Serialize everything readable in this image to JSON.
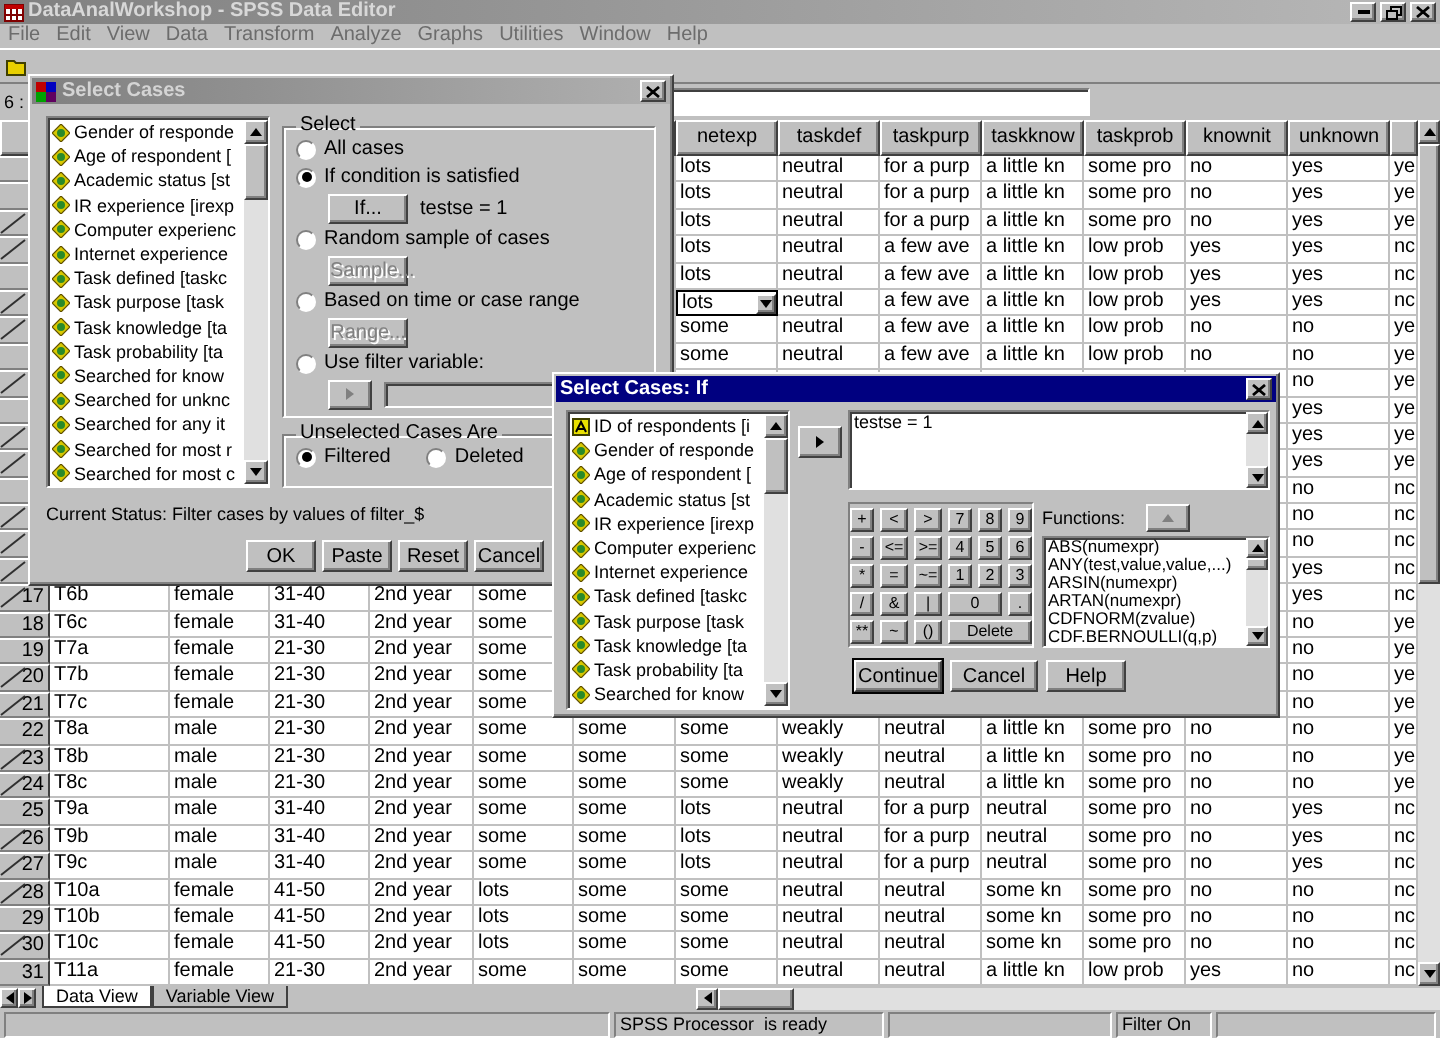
{
  "window": {
    "title": "DataAnalWorkshop - SPSS Data Editor"
  },
  "menu": [
    "File",
    "Edit",
    "View",
    "Data",
    "Transform",
    "Analyze",
    "Graphs",
    "Utilities",
    "Window",
    "Help"
  ],
  "cell_editor": {
    "label": "6 :"
  },
  "grid": {
    "columns": [
      null,
      null,
      null,
      null,
      null,
      null,
      "netexp",
      "taskdef",
      "taskpurp",
      "taskknow",
      "taskprob",
      "knownit",
      "unknown",
      null
    ],
    "rows": [
      {
        "number": null,
        "filtered": false,
        "cells": [
          null,
          null,
          null,
          null,
          null,
          null,
          "lots",
          "neutral",
          "for a purp",
          "a little kn",
          "some pro",
          "no",
          "yes",
          "ye"
        ]
      },
      {
        "number": null,
        "filtered": false,
        "cells": [
          null,
          null,
          null,
          null,
          null,
          null,
          "lots",
          "neutral",
          "for a purp",
          "a little kn",
          "some pro",
          "no",
          "yes",
          "ye"
        ]
      },
      {
        "number": null,
        "filtered": true,
        "cells": [
          null,
          null,
          null,
          null,
          null,
          null,
          "lots",
          "neutral",
          "for a purp",
          "a little kn",
          "some pro",
          "no",
          "yes",
          "ye"
        ]
      },
      {
        "number": null,
        "filtered": true,
        "cells": [
          null,
          null,
          null,
          null,
          null,
          null,
          "lots",
          "neutral",
          "a few ave",
          "a little kn",
          "low prob",
          "yes",
          "yes",
          "nc"
        ]
      },
      {
        "number": null,
        "filtered": false,
        "cells": [
          null,
          null,
          null,
          null,
          null,
          null,
          "lots",
          "neutral",
          "a few ave",
          "a little kn",
          "low prob",
          "yes",
          "yes",
          "nc"
        ]
      },
      {
        "number": null,
        "filtered": true,
        "cells": [
          null,
          null,
          null,
          null,
          null,
          null,
          {
            "text": "lots",
            "dropdown": true
          },
          "neutral",
          "a few ave",
          "a little kn",
          "low prob",
          "yes",
          "yes",
          "nc"
        ]
      },
      {
        "number": null,
        "filtered": true,
        "cells": [
          null,
          null,
          null,
          null,
          null,
          null,
          "some",
          "neutral",
          "a few ave",
          "a little kn",
          "low prob",
          "no",
          "no",
          "ye"
        ]
      },
      {
        "number": null,
        "filtered": false,
        "cells": [
          null,
          null,
          null,
          null,
          null,
          null,
          "some",
          "neutral",
          "a few ave",
          "a little kn",
          "low prob",
          "no",
          "no",
          "ye"
        ]
      },
      {
        "number": null,
        "filtered": true,
        "cells": [
          null,
          null,
          null,
          null,
          null,
          null,
          null,
          null,
          null,
          null,
          null,
          null,
          "no",
          "ye"
        ]
      },
      {
        "number": null,
        "filtered": false,
        "cells": [
          null,
          null,
          null,
          null,
          null,
          null,
          null,
          null,
          null,
          null,
          null,
          null,
          "yes",
          "ye"
        ]
      },
      {
        "number": null,
        "filtered": true,
        "cells": [
          null,
          null,
          null,
          null,
          null,
          null,
          null,
          null,
          null,
          null,
          null,
          null,
          "yes",
          "ye"
        ]
      },
      {
        "number": null,
        "filtered": true,
        "cells": [
          null,
          null,
          null,
          null,
          null,
          null,
          null,
          null,
          null,
          null,
          null,
          null,
          "yes",
          "ye"
        ]
      },
      {
        "number": null,
        "filtered": false,
        "cells": [
          null,
          null,
          null,
          null,
          null,
          null,
          null,
          null,
          null,
          null,
          null,
          null,
          "no",
          "nc"
        ]
      },
      {
        "number": null,
        "filtered": true,
        "cells": [
          null,
          null,
          null,
          null,
          null,
          null,
          null,
          null,
          null,
          null,
          null,
          null,
          "no",
          "nc"
        ]
      },
      {
        "number": null,
        "filtered": true,
        "cells": [
          null,
          null,
          null,
          null,
          null,
          null,
          null,
          null,
          null,
          null,
          null,
          null,
          "no",
          "nc"
        ]
      },
      {
        "number": null,
        "filtered": true,
        "cells": [
          null,
          null,
          null,
          null,
          null,
          null,
          null,
          null,
          null,
          null,
          null,
          null,
          "yes",
          "nc"
        ]
      },
      {
        "number": "17",
        "filtered": true,
        "cells": [
          "T6b",
          "female",
          "31-40",
          "2nd year",
          "some",
          null,
          null,
          null,
          null,
          null,
          null,
          null,
          "yes",
          "nc"
        ]
      },
      {
        "number": "18",
        "filtered": false,
        "cells": [
          "T6c",
          "female",
          "31-40",
          "2nd year",
          "some",
          null,
          null,
          null,
          null,
          null,
          null,
          null,
          "no",
          "ye"
        ]
      },
      {
        "number": "19",
        "filtered": false,
        "cells": [
          "T7a",
          "female",
          "21-30",
          "2nd year",
          "some",
          null,
          null,
          null,
          null,
          null,
          null,
          null,
          "no",
          "ye"
        ]
      },
      {
        "number": "20",
        "filtered": true,
        "cells": [
          "T7b",
          "female",
          "21-30",
          "2nd year",
          "some",
          null,
          null,
          null,
          null,
          null,
          null,
          null,
          "no",
          "ye"
        ]
      },
      {
        "number": "21",
        "filtered": true,
        "cells": [
          "T7c",
          "female",
          "21-30",
          "2nd year",
          "some",
          null,
          null,
          null,
          null,
          null,
          null,
          null,
          "no",
          "ye"
        ]
      },
      {
        "number": "22",
        "filtered": false,
        "cells": [
          "T8a",
          "male",
          "21-30",
          "2nd year",
          "some",
          "some",
          "some",
          "weakly",
          "neutral",
          "a little kn",
          "some pro",
          "no",
          "no",
          "ye"
        ]
      },
      {
        "number": "23",
        "filtered": true,
        "cells": [
          "T8b",
          "male",
          "21-30",
          "2nd year",
          "some",
          "some",
          "some",
          "weakly",
          "neutral",
          "a little kn",
          "some pro",
          "no",
          "no",
          "ye"
        ]
      },
      {
        "number": "24",
        "filtered": true,
        "cells": [
          "T8c",
          "male",
          "21-30",
          "2nd year",
          "some",
          "some",
          "some",
          "weakly",
          "neutral",
          "a little kn",
          "some pro",
          "no",
          "no",
          "ye"
        ]
      },
      {
        "number": "25",
        "filtered": false,
        "cells": [
          "T9a",
          "male",
          "31-40",
          "2nd year",
          "some",
          "some",
          "lots",
          "neutral",
          "for a purp",
          "neutral",
          "some pro",
          "no",
          "yes",
          "nc"
        ]
      },
      {
        "number": "26",
        "filtered": true,
        "cells": [
          "T9b",
          "male",
          "31-40",
          "2nd year",
          "some",
          "some",
          "lots",
          "neutral",
          "for a purp",
          "neutral",
          "some pro",
          "no",
          "yes",
          "nc"
        ]
      },
      {
        "number": "27",
        "filtered": true,
        "cells": [
          "T9c",
          "male",
          "31-40",
          "2nd year",
          "some",
          "some",
          "lots",
          "neutral",
          "for a purp",
          "neutral",
          "some pro",
          "no",
          "yes",
          "nc"
        ]
      },
      {
        "number": "28",
        "filtered": true,
        "cells": [
          "T10a",
          "female",
          "41-50",
          "2nd year",
          "lots",
          "some",
          "some",
          "neutral",
          "neutral",
          "some kn",
          "some pro",
          "no",
          "no",
          "nc"
        ]
      },
      {
        "number": "29",
        "filtered": false,
        "cells": [
          "T10b",
          "female",
          "41-50",
          "2nd year",
          "lots",
          "some",
          "some",
          "neutral",
          "neutral",
          "some kn",
          "some pro",
          "no",
          "no",
          "nc"
        ]
      },
      {
        "number": "30",
        "filtered": true,
        "cells": [
          "T10c",
          "female",
          "41-50",
          "2nd year",
          "lots",
          "some",
          "some",
          "neutral",
          "neutral",
          "some kn",
          "some pro",
          "no",
          "no",
          "nc"
        ]
      },
      {
        "number": "31",
        "filtered": false,
        "cells": [
          "T11a",
          "female",
          "21-30",
          "2nd year",
          "some",
          "some",
          "some",
          "neutral",
          "neutral",
          "a little kn",
          "low prob",
          "yes",
          "no",
          "nc"
        ]
      }
    ]
  },
  "sheet_tabs": [
    {
      "label": "Data View",
      "selected": true
    },
    {
      "label": "Variable View",
      "selected": false
    }
  ],
  "status_bar": {
    "processor": "SPSS Processor  is ready",
    "filter": "Filter On"
  },
  "select_cases": {
    "title": "Select Cases",
    "variables": [
      {
        "label": "Gender of responde",
        "kind": "numeric"
      },
      {
        "label": "Age of respondent [",
        "kind": "numeric"
      },
      {
        "label": "Academic status [st",
        "kind": "numeric"
      },
      {
        "label": "IR experience [irexp",
        "kind": "numeric"
      },
      {
        "label": "Computer experienc",
        "kind": "numeric"
      },
      {
        "label": "Internet experience",
        "kind": "numeric"
      },
      {
        "label": "Task defined [taskc",
        "kind": "numeric"
      },
      {
        "label": "Task purpose [task",
        "kind": "numeric"
      },
      {
        "label": "Task knowledge [ta",
        "kind": "numeric"
      },
      {
        "label": "Task probability [ta",
        "kind": "numeric"
      },
      {
        "label": "Searched for know",
        "kind": "numeric"
      },
      {
        "label": "Searched for unknc",
        "kind": "numeric"
      },
      {
        "label": "Searched for any it",
        "kind": "numeric"
      },
      {
        "label": "Searched for most r",
        "kind": "numeric"
      },
      {
        "label": "Searched for most c",
        "kind": "numeric"
      }
    ],
    "select_group": {
      "title": "Select",
      "options": [
        {
          "label": "All cases",
          "selected": false
        },
        {
          "label": "If condition is satisfied",
          "selected": true,
          "button": {
            "label": "If...",
            "disabled": false
          },
          "condition": "testse = 1"
        },
        {
          "label": "Random sample of cases",
          "selected": false,
          "button": {
            "label": "Sample...",
            "disabled": true
          }
        },
        {
          "label": "Based on time or case range",
          "selected": false,
          "button": {
            "label": "Range...",
            "disabled": true
          }
        },
        {
          "label": "Use filter variable:",
          "selected": false,
          "variable_picker": {
            "disabled": true
          }
        }
      ]
    },
    "unselected_group": {
      "title": "Unselected Cases Are",
      "options": [
        {
          "label": "Filtered",
          "selected": true
        },
        {
          "label": "Deleted",
          "selected": false
        }
      ]
    },
    "status": "Current Status: Filter cases by values of filter_$",
    "buttons": [
      {
        "label": "OK"
      },
      {
        "label": "Paste"
      },
      {
        "label": "Reset"
      },
      {
        "label": "Cancel"
      }
    ]
  },
  "select_if": {
    "title": "Select Cases: If",
    "variables": [
      {
        "label": "ID of respondents [i",
        "kind": "string"
      },
      {
        "label": "Gender of responde",
        "kind": "numeric"
      },
      {
        "label": "Age of respondent [",
        "kind": "numeric"
      },
      {
        "label": "Academic status [st",
        "kind": "numeric"
      },
      {
        "label": "IR experience [irexp",
        "kind": "numeric"
      },
      {
        "label": "Computer experienc",
        "kind": "numeric"
      },
      {
        "label": "Internet experience",
        "kind": "numeric"
      },
      {
        "label": "Task defined [taskc",
        "kind": "numeric"
      },
      {
        "label": "Task purpose [task",
        "kind": "numeric"
      },
      {
        "label": "Task knowledge [ta",
        "kind": "numeric"
      },
      {
        "label": "Task probability [ta",
        "kind": "numeric"
      },
      {
        "label": "Searched for know",
        "kind": "numeric"
      }
    ],
    "expression": "testse = 1",
    "keypad": [
      [
        "+",
        "<",
        ">",
        "7",
        "8",
        "9"
      ],
      [
        "-",
        "<=",
        ">=",
        "4",
        "5",
        "6"
      ],
      [
        "*",
        "=",
        "~=",
        "1",
        "2",
        "3"
      ],
      [
        "/",
        "&",
        "|",
        {
          "label": "0",
          "wide": true
        },
        "."
      ],
      [
        "**",
        "~",
        "()",
        {
          "label": "Delete",
          "wide": true
        }
      ]
    ],
    "functions_label": "Functions:",
    "functions": [
      "ABS(numexpr)",
      "ANY(test,value,value,...)",
      "ARSIN(numexpr)",
      "ARTAN(numexpr)",
      "CDFNORM(zvalue)",
      "CDF.BERNOULLI(q,p)"
    ],
    "buttons": [
      {
        "label": "Continue",
        "default": true
      },
      {
        "label": "Cancel",
        "default": false
      },
      {
        "label": "Help",
        "default": false
      }
    ]
  }
}
